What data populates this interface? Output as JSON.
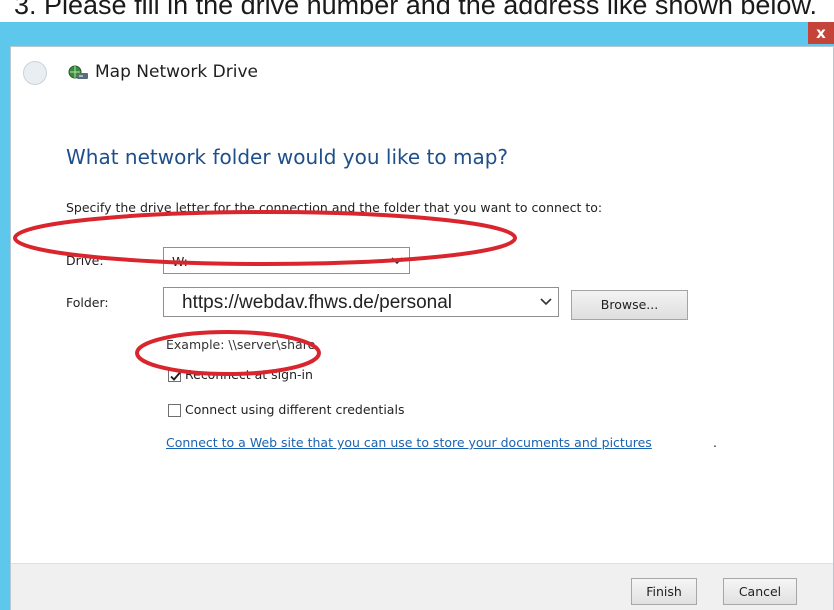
{
  "instruction": "3.   Please fill in the drive number and the address like shown below.",
  "window": {
    "close_label": "x"
  },
  "dialog": {
    "title": "Map Network Drive",
    "heading": "What network folder would you like to map?",
    "subtext": "Specify the drive letter for the connection and the folder that you want to connect to:",
    "drive": {
      "label": "Drive:",
      "value": "W:"
    },
    "folder": {
      "label": "Folder:",
      "value": "https://webdav.fhws.de/personal"
    },
    "browse_label": "Browse...",
    "example": "Example: \\\\server\\share",
    "reconnect": {
      "label": "Reconnect at sign-in",
      "checked": true
    },
    "credentials": {
      "label": "Connect using different credentials",
      "checked": false
    },
    "link_text": "Connect to a Web site that you can use to store your documents and pictures",
    "link_period": ".",
    "finish_label": "Finish",
    "cancel_label": "Cancel"
  },
  "colors": {
    "titlebar": "#5ec8ec",
    "heading": "#1f4f8a",
    "link": "#1a63b0",
    "annotation": "#d9262e",
    "close_button": "#c4443a"
  },
  "icons": {
    "app": "network-drive-icon",
    "back": "back-arrow-icon",
    "dropdown": "chevron-down-icon",
    "check": "checkmark-icon"
  }
}
